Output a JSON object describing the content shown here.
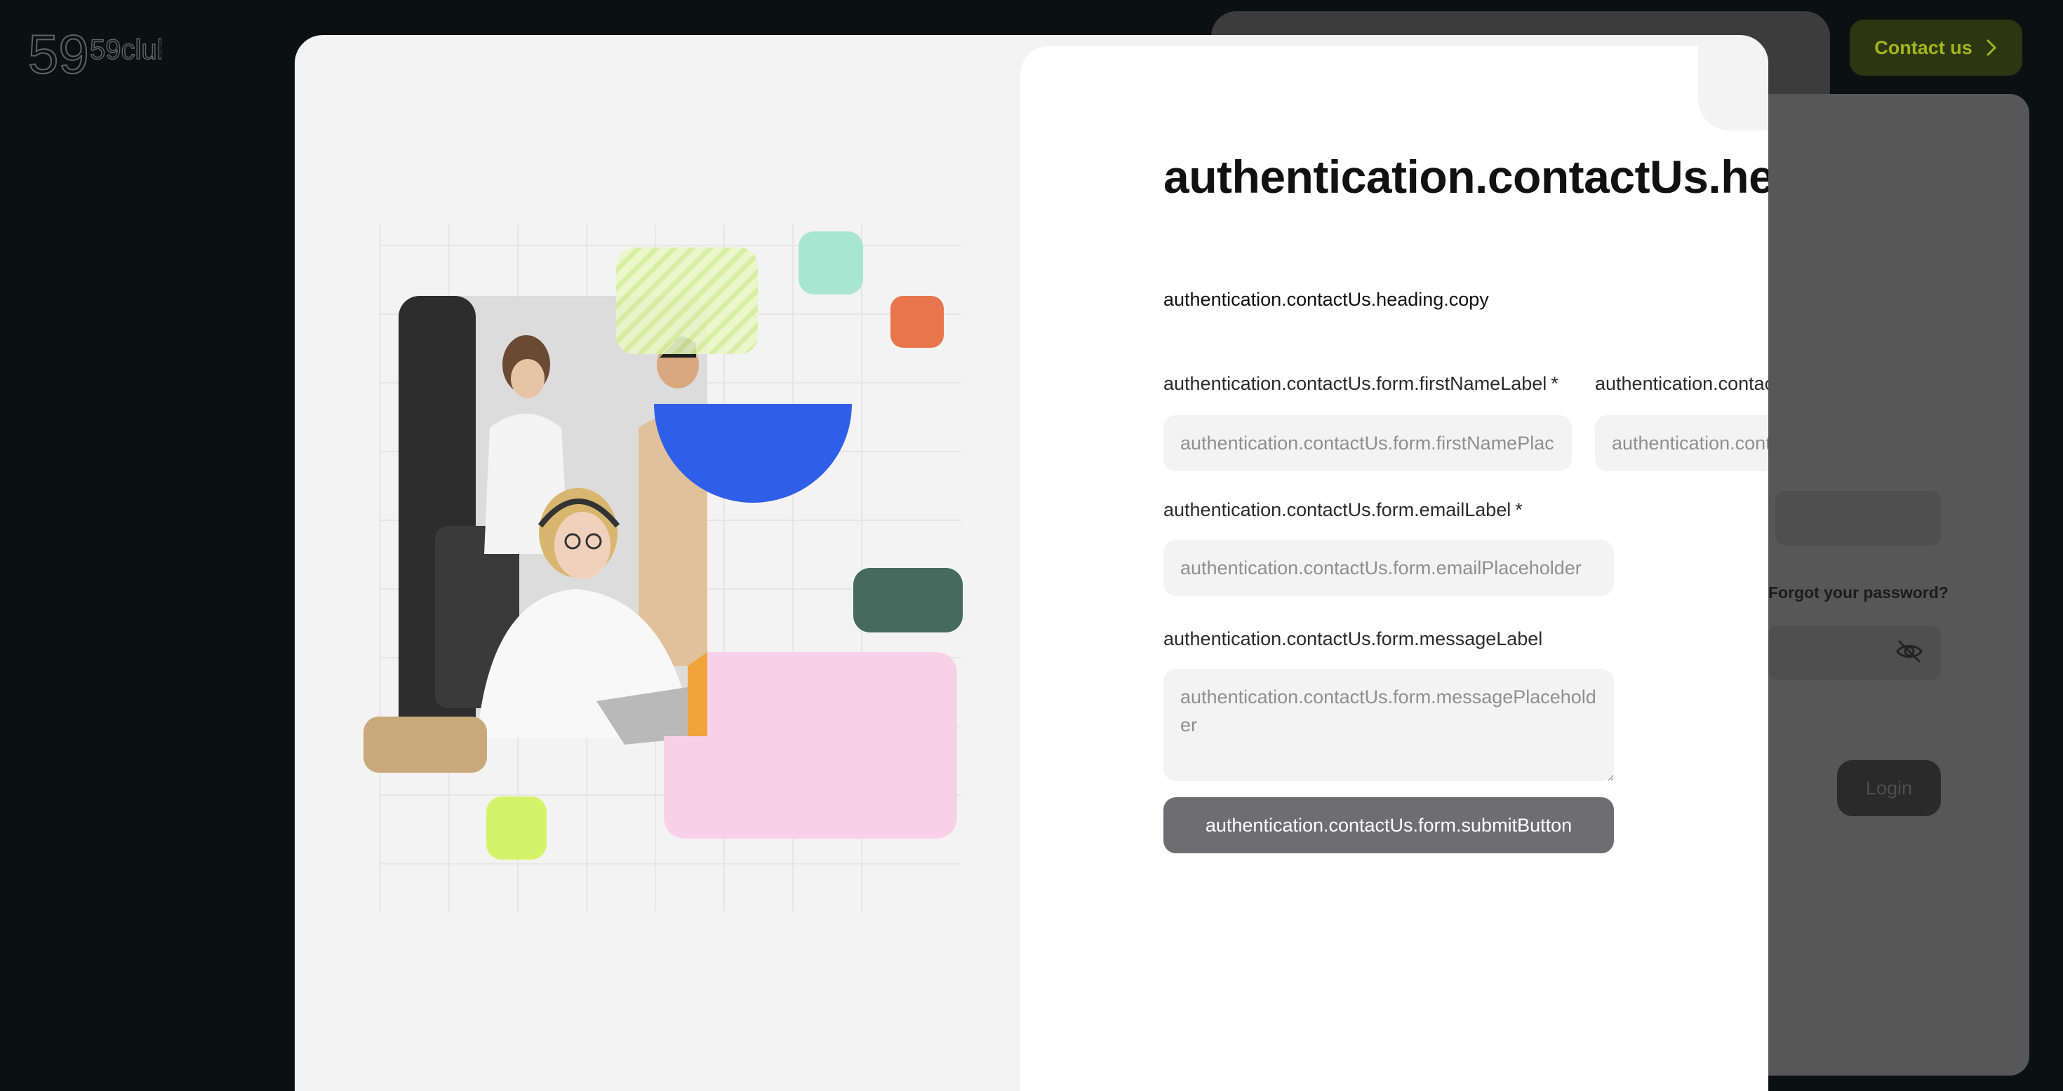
{
  "app": {
    "logo_text": "59club"
  },
  "header": {
    "contact_label": "Contact us"
  },
  "background_login": {
    "forgot_password": "Forgot your password?",
    "login_label": "Login"
  },
  "modal": {
    "heading": "authentication.contactUs.heading.title",
    "copy": "authentication.contactUs.heading.copy",
    "form": {
      "first_name_label": "authentication.contactUs.form.firstNameLabel",
      "first_name_placeholder": "authentication.contactUs.form.firstNamePlaceholder",
      "last_name_label": "authentication.contactUs.form.lastNameLabel",
      "last_name_placeholder": "authentication.contactUs.form.lastNamePlaceholder",
      "email_label": "authentication.contactUs.form.emailLabel",
      "email_placeholder": "authentication.contactUs.form.emailPlaceholder",
      "message_label": "authentication.contactUs.form.messageLabel",
      "message_placeholder": "authentication.contactUs.form.messagePlaceholder",
      "required_mark": "*",
      "submit_label": "authentication.contactUs.form.submitButton"
    }
  },
  "icons": {
    "close": "close-icon",
    "chevron": "chevron-right-icon",
    "eye_off": "eye-off-icon"
  },
  "colors": {
    "accent_blue": "#2f5fe8",
    "accent_mint": "#a8e6d1",
    "accent_orange": "#e8754b",
    "accent_teal": "#456b5f",
    "accent_pink": "#f9d0ea",
    "accent_tan": "#c9a97c",
    "accent_lime": "#d3f46a",
    "submit_bg": "#6e6e72"
  }
}
